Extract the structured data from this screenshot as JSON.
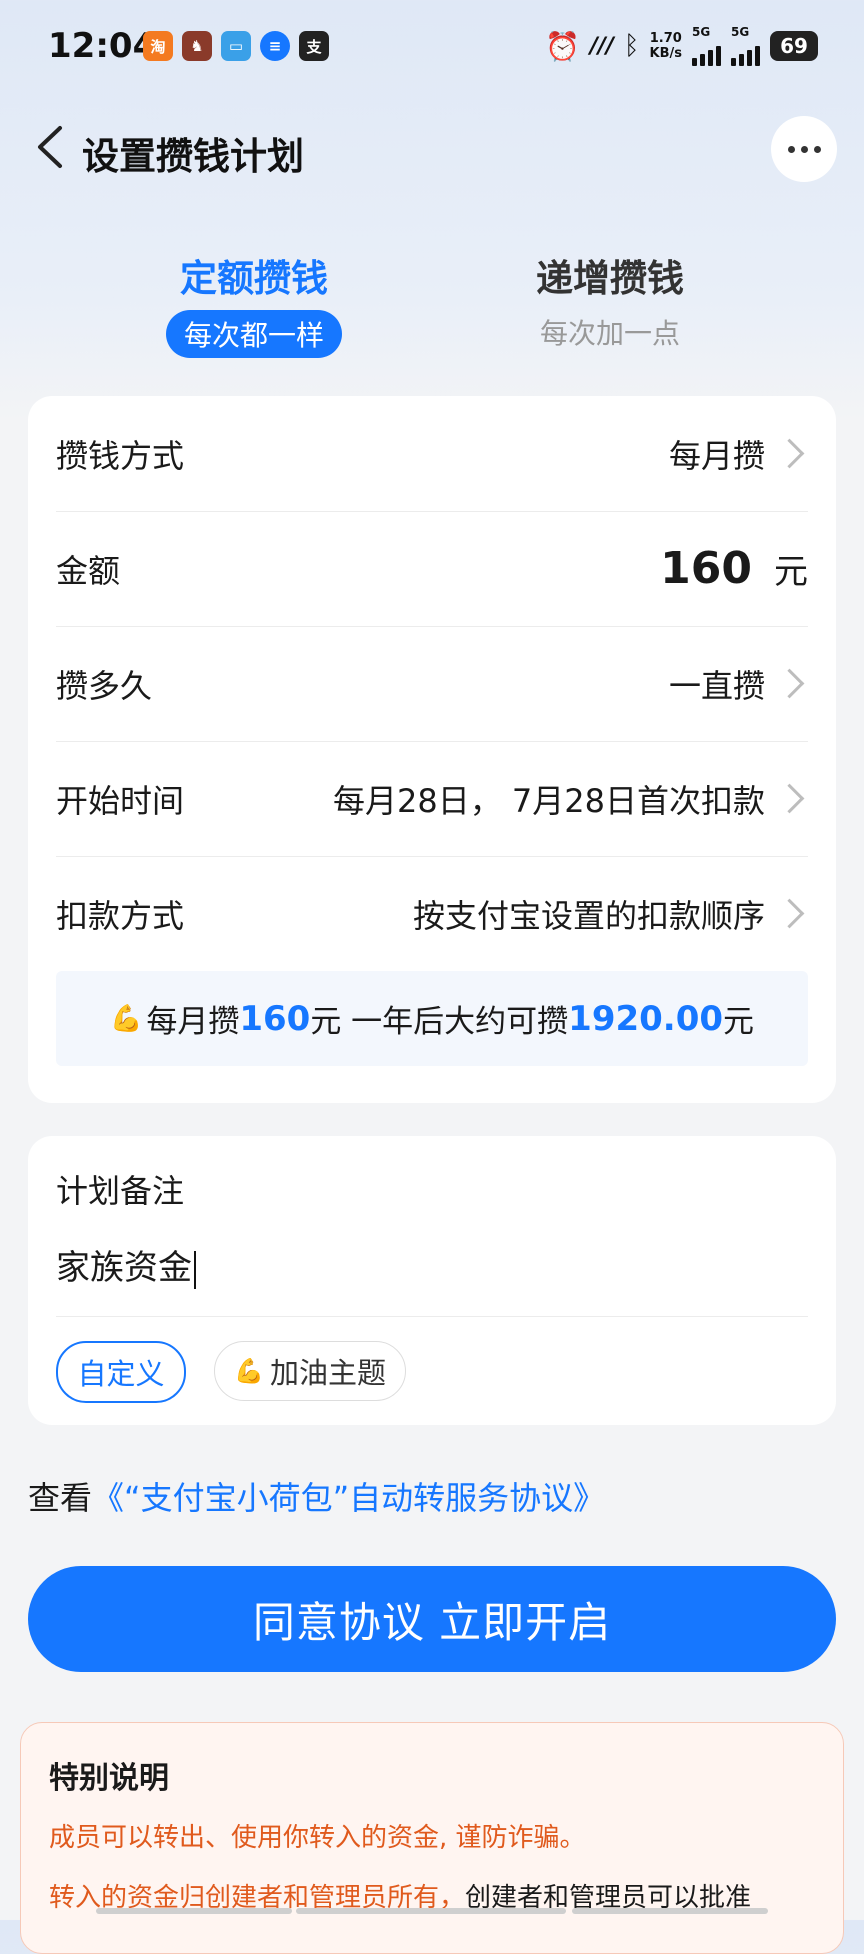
{
  "status_bar": {
    "time": "12:04",
    "net_speed_value": "1.70",
    "net_speed_unit": "KB/s",
    "sim1": "5G",
    "sim2": "5G",
    "battery": "69"
  },
  "header": {
    "title": "设置攒钱计划"
  },
  "tabs": [
    {
      "title": "定额攒钱",
      "subtitle": "每次都一样",
      "active": true
    },
    {
      "title": "递增攒钱",
      "subtitle": "每次加一点",
      "active": false
    }
  ],
  "form": {
    "method": {
      "label": "攒钱方式",
      "value": "每月攒"
    },
    "amount": {
      "label": "金额",
      "value": "160",
      "unit": "元"
    },
    "duration": {
      "label": "攒多久",
      "value": "一直攒"
    },
    "start": {
      "label": "开始时间",
      "value": "每月28日， 7月28日首次扣款"
    },
    "payment": {
      "label": "扣款方式",
      "value": "按支付宝设置的扣款顺序"
    }
  },
  "tip": {
    "prefix": "每月攒",
    "monthly": "160",
    "mid": "元 一年后大约可攒",
    "total": "1920.00",
    "suffix": "元"
  },
  "note": {
    "label": "计划备注",
    "value": "家族资金",
    "chips": [
      "自定义",
      "加油主题"
    ]
  },
  "agreement": {
    "prefix": "查看",
    "link": "《“支付宝小荷包”自动转服务协议》"
  },
  "cta": {
    "label": "同意协议 立即开启"
  },
  "notice": {
    "title": "特别说明",
    "line1": "成员可以转出、使用你转入的资金, 谨防诈骗。",
    "line2_orange": "转入的资金归创建者和管理员所有，",
    "line2_dark": "创建者和管理员可以批准"
  },
  "colors": {
    "accent": "#1677ff",
    "warning": "#e05a1d"
  }
}
